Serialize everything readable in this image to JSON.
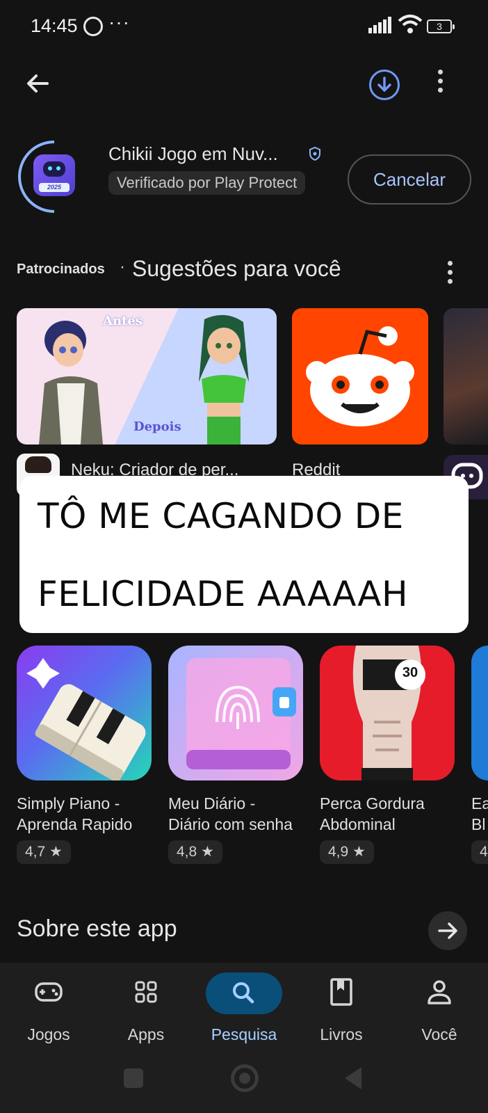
{
  "status_bar": {
    "time": "14:45",
    "overflow": "···",
    "battery": "3"
  },
  "installing": {
    "app_name": "Chikii Jogo em Nuv...",
    "icon_year": "2025",
    "verified_text": "Verificado por Play Protect",
    "cancel_label": "Cancelar"
  },
  "sponsored": {
    "label": "Patrocinados",
    "separator": "·",
    "title": "Sugestões para você",
    "banner1": {
      "before": "Antes",
      "after": "Depois"
    },
    "items": [
      {
        "label": "Neku: Criador de per..."
      },
      {
        "label": "Reddit"
      }
    ]
  },
  "overlay": {
    "line1": "TÔ ME CAGANDO DE",
    "line2": "FELICIDADE AAAAAH"
  },
  "apps": [
    {
      "title": "Simply Piano -\nAprenda Rapido",
      "rating": "4,7 ★"
    },
    {
      "title": "Meu Diário -\nDiário com senha",
      "rating": "4,8 ★"
    },
    {
      "title": "Perca Gordura\nAbdominal",
      "rating": "4,9 ★"
    },
    {
      "title": "Ea\nBl",
      "rating": "4"
    }
  ],
  "tile3_badge": "30",
  "about": {
    "title": "Sobre este app"
  },
  "nav": [
    {
      "label": "Jogos",
      "icon": "gamepad-icon"
    },
    {
      "label": "Apps",
      "icon": "apps-grid-icon"
    },
    {
      "label": "Pesquisa",
      "icon": "search-icon"
    },
    {
      "label": "Livros",
      "icon": "book-icon"
    },
    {
      "label": "Você",
      "icon": "person-icon"
    }
  ],
  "colors": {
    "accent": "#a5d1ff",
    "active_pill": "#0a4f7a",
    "reddit": "#ff4500"
  }
}
